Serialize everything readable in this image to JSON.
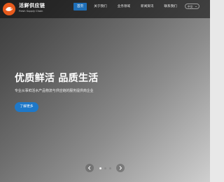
{
  "brand": {
    "name": "活鲜供应链",
    "subtitle": "Fresh Supply Chain"
  },
  "nav": {
    "items": [
      {
        "label": "首页",
        "active": true
      },
      {
        "label": "关于我们",
        "active": false
      },
      {
        "label": "业务领域",
        "active": false
      },
      {
        "label": "新闻资讯",
        "active": false
      },
      {
        "label": "联系我们",
        "active": false
      }
    ],
    "language": "中文"
  },
  "hero": {
    "title": "优质鲜活 品质生活",
    "subtitle": "专业从事鲜活水产品物流与供应链的服务提供商企业",
    "cta_label": "了解更多"
  },
  "carousel": {
    "slide_count": 3,
    "active_index": 0
  },
  "colors": {
    "accent": "#1e78c8",
    "nav_active": "#1e6fb8",
    "logo_orange": "#e85a1c"
  },
  "icons": {
    "logo": "brand-logo-icon",
    "language": "chevron-down-icon",
    "prev": "chevron-left-icon",
    "next": "chevron-right-icon"
  }
}
